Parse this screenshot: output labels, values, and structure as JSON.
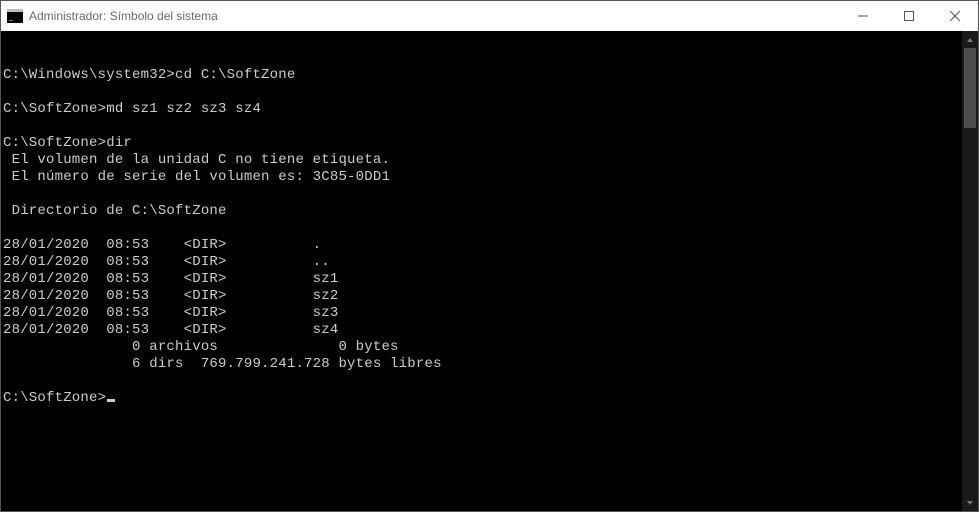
{
  "window": {
    "title": "Administrador: Símbolo del sistema"
  },
  "terminal": {
    "lines": [
      {
        "prompt": "C:\\Windows\\system32>",
        "command": "cd C:\\SoftZone"
      },
      {
        "blank": true
      },
      {
        "prompt": "C:\\SoftZone>",
        "command": "md sz1 sz2 sz3 sz4"
      },
      {
        "blank": true
      },
      {
        "prompt": "C:\\SoftZone>",
        "command": "dir"
      },
      {
        "output": " El volumen de la unidad C no tiene etiqueta."
      },
      {
        "output": " El número de serie del volumen es: 3C85-0DD1"
      },
      {
        "blank": true
      },
      {
        "output": " Directorio de C:\\SoftZone"
      },
      {
        "blank": true
      },
      {
        "output": "28/01/2020  08:53    <DIR>          ."
      },
      {
        "output": "28/01/2020  08:53    <DIR>          .."
      },
      {
        "output": "28/01/2020  08:53    <DIR>          sz1"
      },
      {
        "output": "28/01/2020  08:53    <DIR>          sz2"
      },
      {
        "output": "28/01/2020  08:53    <DIR>          sz3"
      },
      {
        "output": "28/01/2020  08:53    <DIR>          sz4"
      },
      {
        "output": "               0 archivos              0 bytes"
      },
      {
        "output": "               6 dirs  769.799.241.728 bytes libres"
      },
      {
        "blank": true
      },
      {
        "prompt": "C:\\SoftZone>",
        "command": "",
        "cursor": true
      }
    ],
    "dir_listing": {
      "volume_label_line": "El volumen de la unidad C no tiene etiqueta.",
      "serial": "3C85-0DD1",
      "directory": "C:\\SoftZone",
      "entries": [
        {
          "date": "28/01/2020",
          "time": "08:53",
          "type": "<DIR>",
          "name": "."
        },
        {
          "date": "28/01/2020",
          "time": "08:53",
          "type": "<DIR>",
          "name": ".."
        },
        {
          "date": "28/01/2020",
          "time": "08:53",
          "type": "<DIR>",
          "name": "sz1"
        },
        {
          "date": "28/01/2020",
          "time": "08:53",
          "type": "<DIR>",
          "name": "sz2"
        },
        {
          "date": "28/01/2020",
          "time": "08:53",
          "type": "<DIR>",
          "name": "sz3"
        },
        {
          "date": "28/01/2020",
          "time": "08:53",
          "type": "<DIR>",
          "name": "sz4"
        }
      ],
      "file_count": 0,
      "file_bytes": "0 bytes",
      "dir_count": 6,
      "free_bytes": "769.799.241.728 bytes libres"
    }
  }
}
